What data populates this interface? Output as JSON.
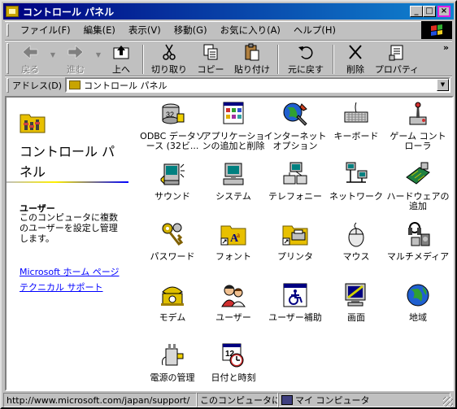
{
  "window": {
    "title": "コントロール パネル",
    "controls": {
      "minimize": "_",
      "maximize": "□",
      "close": "×"
    }
  },
  "menubar": {
    "items": [
      {
        "label": "ファイル(F)"
      },
      {
        "label": "編集(E)"
      },
      {
        "label": "表示(V)"
      },
      {
        "label": "移動(G)"
      },
      {
        "label": "お気に入り(A)"
      },
      {
        "label": "ヘルプ(H)"
      }
    ]
  },
  "toolbar": {
    "back": "戻る",
    "forward": "進む",
    "up": "上へ",
    "cut": "切り取り",
    "copy": "コピー",
    "paste": "貼り付け",
    "undo": "元に戻す",
    "delete": "削除",
    "properties": "プロパティ",
    "more": "»"
  },
  "address": {
    "label": "アドレス(D)",
    "value": "コントロール パネル"
  },
  "left_panel": {
    "title": "コントロール パネル",
    "selected_title": "ユーザー",
    "selected_desc": "このコンピュータに複数のユーザーを設定し管理します。",
    "links": [
      "Microsoft ホーム ページ",
      "テクニカル サポート"
    ]
  },
  "icons": [
    {
      "label": "ODBC データソース (32ビ..."
    },
    {
      "label": "アプリケーションの追加と削除"
    },
    {
      "label": "インターネットオプション"
    },
    {
      "label": "キーボード"
    },
    {
      "label": "ゲーム コントローラ"
    },
    {
      "label": "サウンド"
    },
    {
      "label": "システム"
    },
    {
      "label": "テレフォニー"
    },
    {
      "label": "ネットワーク"
    },
    {
      "label": "ハードウェアの追加"
    },
    {
      "label": "パスワード"
    },
    {
      "label": "フォント"
    },
    {
      "label": "プリンタ"
    },
    {
      "label": "マウス"
    },
    {
      "label": "マルチメディア"
    },
    {
      "label": "モデム"
    },
    {
      "label": "ユーザー"
    },
    {
      "label": "ユーザー補助"
    },
    {
      "label": "画面"
    },
    {
      "label": "地域"
    },
    {
      "label": "電源の管理"
    },
    {
      "label": "日付と時刻"
    }
  ],
  "status": {
    "url": "http://www.microsoft.com/japan/support/",
    "desc": "このコンピュータに複",
    "zone": "マイ コンピュータ"
  },
  "colors": {
    "title_start": "#000080",
    "title_end": "#1084d0",
    "link": "#0000ff",
    "folder": "#c8a400"
  }
}
